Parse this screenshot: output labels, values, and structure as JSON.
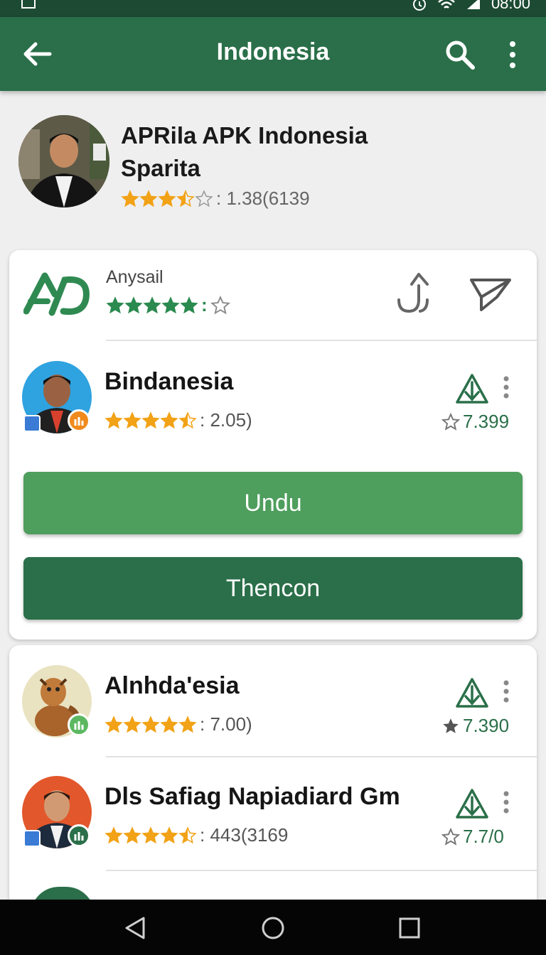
{
  "status_bar": {
    "time": "08:00"
  },
  "app_bar": {
    "title": "Indonesia"
  },
  "header": {
    "title_line1": "APRila APK Indonesia",
    "title_line2": "Sparita",
    "rating_text": ": 1.38(6139",
    "star_rating": 3.5
  },
  "developer": {
    "name": "Anysail",
    "rating_text": ":",
    "star_rating": 5
  },
  "featured_app": {
    "name": "Bindanesia",
    "rating_text": ": 2.05)",
    "star_rating": 4.5,
    "size_text": "7.399",
    "primary_button": "Undu",
    "secondary_button": "Thencon"
  },
  "app_list": [
    {
      "name": "Alnhda'esia",
      "rating_text": ": 7.00)",
      "star_rating": 5,
      "size_text": "7.390"
    },
    {
      "name": "Dls Safiag Napiadiard Gm",
      "rating_text": ": 443(3169",
      "star_rating": 4.5,
      "size_text": "7.7/0"
    }
  ],
  "colors": {
    "primary": "#2a6f49",
    "button_light": "#4e9e5d",
    "star": "#f2a216",
    "dev_star": "#2a8a4f"
  }
}
